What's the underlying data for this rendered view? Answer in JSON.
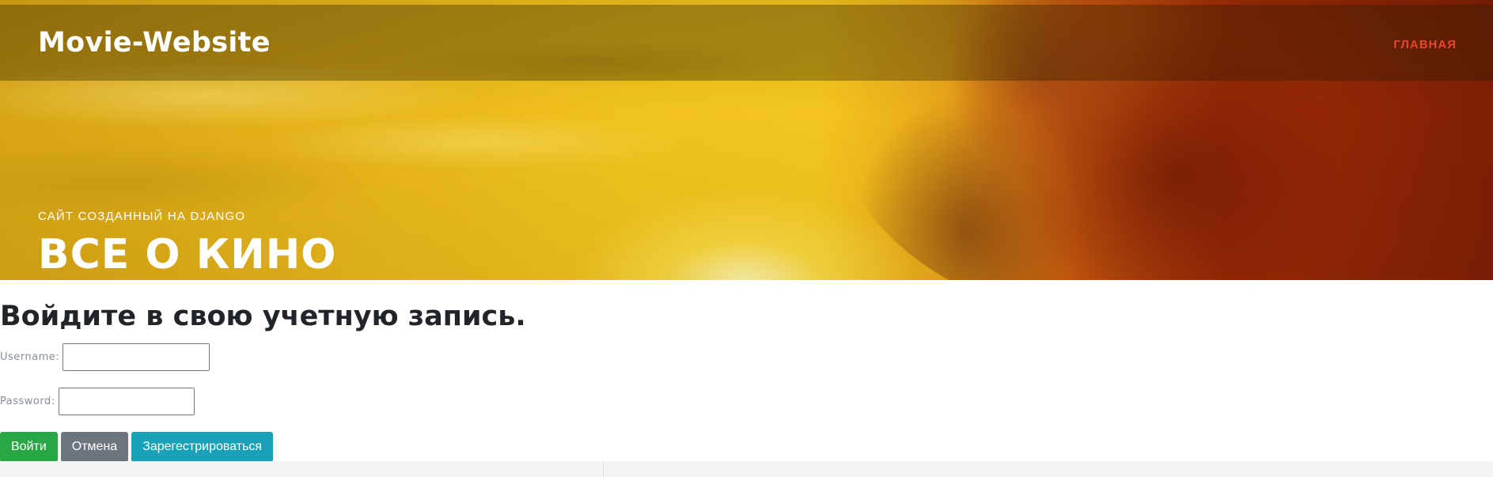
{
  "navbar": {
    "brand": "Movie-Website",
    "links": [
      {
        "label": "ГЛАВНАЯ"
      }
    ]
  },
  "hero": {
    "subtitle": "САЙТ СОЗДАННЫЙ НА DJANGO",
    "title": "ВСЕ О КИНО"
  },
  "login": {
    "heading": "Войдите в свою учетную запись.",
    "username_label": "Username:",
    "username_value": "",
    "password_label": "Password:",
    "password_value": ""
  },
  "buttons": {
    "login": "Войти",
    "cancel": "Отмена",
    "register": "Зарегестрироваться"
  },
  "colors": {
    "nav_link": "#e8472d",
    "login_button": "#28a745",
    "cancel_button": "#6c757d",
    "register_button": "#17a2b8"
  }
}
